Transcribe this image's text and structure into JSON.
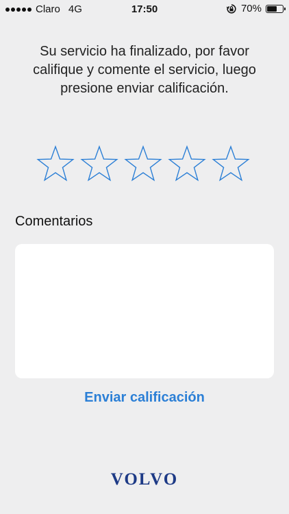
{
  "status_bar": {
    "carrier": "Claro",
    "network": "4G",
    "time": "17:50",
    "battery_text": "70%",
    "battery_level": 0.7
  },
  "instructions": "Su servicio ha finalizado, por favor califique y comente el servicio, luego presione enviar calificación.",
  "rating": {
    "max_stars": 5,
    "selected": 0,
    "star_color": "#2b7fd6"
  },
  "comments": {
    "label": "Comentarios",
    "value": ""
  },
  "submit_label": "Enviar calificación",
  "brand": "VOLVO",
  "colors": {
    "accent": "#2b7fd6",
    "background": "#eeeeef",
    "brand": "#1d3a86"
  }
}
